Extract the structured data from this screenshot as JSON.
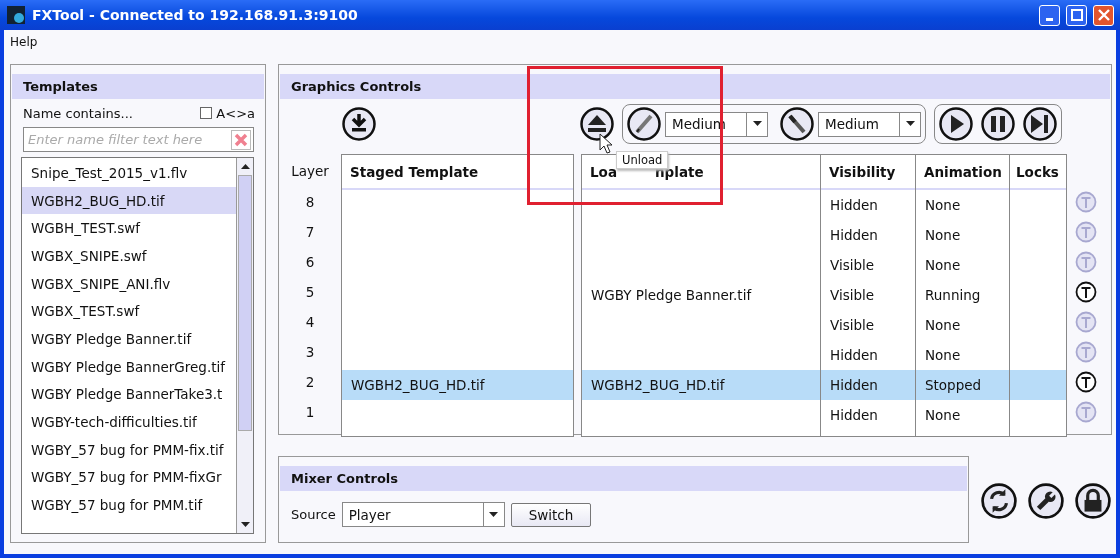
{
  "window": {
    "title": "FXTool - Connected to 192.168.91.3:9100"
  },
  "menu": [
    "Help"
  ],
  "templates": {
    "title": "Templates",
    "filter_label": "Name contains...",
    "case_toggle": {
      "label": "A<>a",
      "checked": false
    },
    "filter": {
      "placeholder": "Enter name filter text here"
    },
    "items": [
      {
        "name": "Snipe_Test_2015_v1.flv",
        "selected": false
      },
      {
        "name": "WGBH2_BUG_HD.tif",
        "selected": true
      },
      {
        "name": "WGBH_TEST.swf",
        "selected": false
      },
      {
        "name": "WGBX_SNIPE.swf",
        "selected": false
      },
      {
        "name": "WGBX_SNIPE_ANI.flv",
        "selected": false
      },
      {
        "name": "WGBX_TEST.swf",
        "selected": false
      },
      {
        "name": "WGBY Pledge Banner.tif",
        "selected": false
      },
      {
        "name": "WGBY Pledge BannerGreg.tif",
        "selected": false
      },
      {
        "name": "WGBY Pledge BannerTake3.t",
        "selected": false
      },
      {
        "name": "WGBY-tech-difficulties.tif",
        "selected": false
      },
      {
        "name": "WGBY_57 bug for PMM-fix.tif",
        "selected": false
      },
      {
        "name": "WGBY_57 bug for PMM-fixGr",
        "selected": false
      },
      {
        "name": "WGBY_57 bug for PMM.tif",
        "selected": false
      }
    ]
  },
  "graphics": {
    "title": "Graphics Controls",
    "transition_in": "Medium",
    "transition_out": "Medium",
    "tooltip": "Unload",
    "columns": {
      "layer": "Layer",
      "staged": "Staged Template",
      "loaded": [
        "Loa",
        "nplate"
      ],
      "visibility": "Visibility",
      "animation": "Animation",
      "locks": "Locks"
    },
    "rows": [
      {
        "layer": "8",
        "visibility": "Hidden",
        "animation": "None",
        "selected": false,
        "locked": false
      },
      {
        "layer": "7",
        "visibility": "Hidden",
        "animation": "None",
        "selected": false,
        "locked": false
      },
      {
        "layer": "6",
        "visibility": "Visible",
        "animation": "None",
        "selected": false,
        "locked": false
      },
      {
        "layer": "5",
        "loaded": "WGBY Pledge Banner.tif",
        "visibility": "Visible",
        "animation": "Running",
        "selected": false,
        "locked": true
      },
      {
        "layer": "4",
        "visibility": "Visible",
        "animation": "None",
        "selected": false,
        "locked": false
      },
      {
        "layer": "3",
        "visibility": "Hidden",
        "animation": "None",
        "selected": false,
        "locked": false
      },
      {
        "layer": "2",
        "staged": "WGBH2_BUG_HD.tif",
        "loaded": "WGBH2_BUG_HD.tif",
        "visibility": "Hidden",
        "animation": "Stopped",
        "selected": true,
        "locked": true
      },
      {
        "layer": "1",
        "visibility": "Hidden",
        "animation": "None",
        "selected": false,
        "locked": false
      }
    ]
  },
  "mixer": {
    "title": "Mixer Controls",
    "source_label": "Source",
    "source": "Player",
    "switch_button": "Switch"
  }
}
